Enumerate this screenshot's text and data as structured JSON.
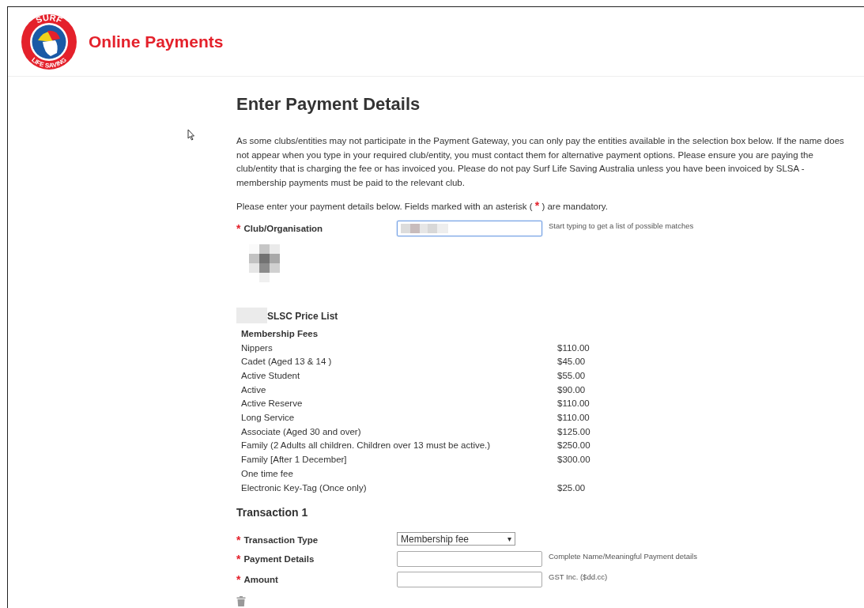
{
  "header": {
    "logo_top": "SURF",
    "logo_bottom": "LIFE SAVING",
    "title": "Online Payments"
  },
  "heading": "Enter Payment Details",
  "intro": "As some clubs/entities may not participate in the Payment Gateway, you can only pay the entities available in the selection box below. If the name does not appear when you type in your required club/entity, you must contact them for alternative payment options. Please ensure you are paying the club/entity that is charging the fee or has invoiced you. Please do not pay Surf Life Saving Australia unless you have been invoiced by SLSA - membership payments must be paid to the relevant club.",
  "mandatory_note": {
    "before": "Please enter your payment details below. Fields marked with an asterisk (",
    "asterisk": "*",
    "after": ") are mandatory."
  },
  "club_field": {
    "label": "Club/Organisation",
    "required": true,
    "hint": "Start typing to get a list of possible matches",
    "focused": true
  },
  "price_list": {
    "title": "SLSC Price List",
    "section": "Membership Fees",
    "rows": [
      {
        "item": "Nippers",
        "price": "$110.00"
      },
      {
        "item": "Cadet (Aged 13 & 14 )",
        "price": "$45.00"
      },
      {
        "item": "Active Student",
        "price": "$55.00"
      },
      {
        "item": "Active",
        "price": "$90.00"
      },
      {
        "item": "Active Reserve",
        "price": "$110.00"
      },
      {
        "item": "Long Service",
        "price": "$110.00"
      },
      {
        "item": "Associate (Aged 30 and over)",
        "price": "$125.00"
      },
      {
        "item": "Family (2 Adults all children. Children over 13 must be active.)",
        "price": "$250.00"
      },
      {
        "item": "Family [After 1 December]",
        "price": "$300.00"
      },
      {
        "item": "One time fee"
      },
      {
        "item": "Electronic Key-Tag (Once only)",
        "price": "$25.00"
      }
    ]
  },
  "transaction": {
    "title": "Transaction 1",
    "fields": [
      {
        "kind": "select",
        "label": "Transaction Type",
        "required": true,
        "value": "Membership fee",
        "caret": "▾"
      },
      {
        "kind": "text",
        "label": "Payment Details",
        "required": true,
        "hint": "Complete Name/Meaningful Payment details"
      },
      {
        "kind": "text",
        "label": "Amount",
        "required": true,
        "hint": "GST Inc. ($dd.cc)"
      }
    ]
  }
}
